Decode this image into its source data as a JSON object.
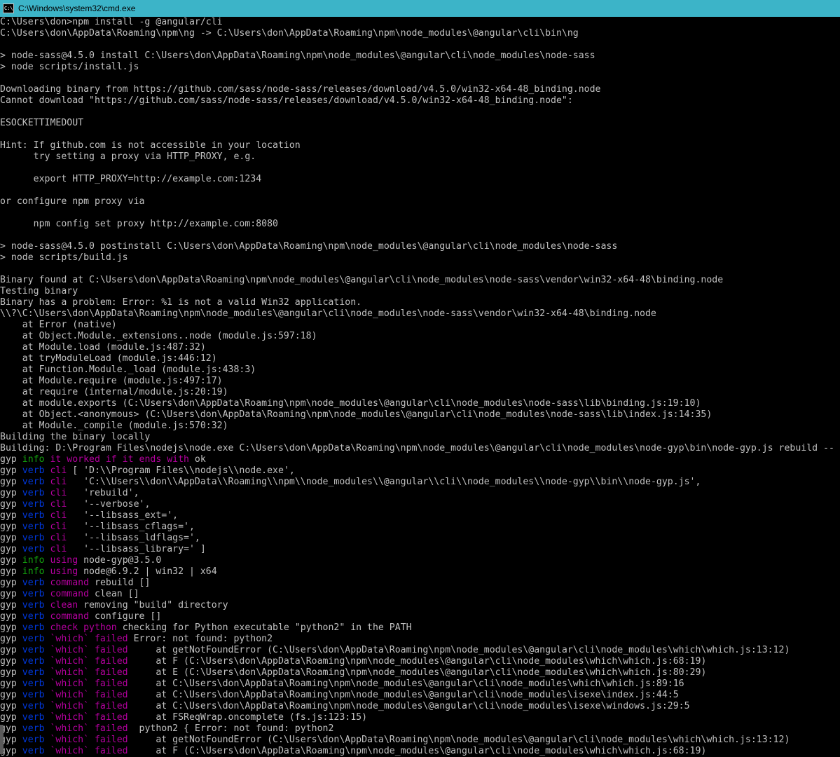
{
  "window": {
    "title": "C:\\Windows\\system32\\cmd.exe",
    "icon": "cmd-icon",
    "icon_text": "C:\\"
  },
  "colors": {
    "titlebar": "#3cb4c8",
    "background": "#000000",
    "default": "#c0c0c0",
    "green": "#13a10e",
    "magenta": "#b4009e",
    "blue": "#0037da"
  },
  "lines": [
    [
      {
        "t": "C:\\Users\\don>npm install -g @angular/cli",
        "c": "default"
      }
    ],
    [
      {
        "t": "C:\\Users\\don\\AppData\\Roaming\\npm\\ng -> C:\\Users\\don\\AppData\\Roaming\\npm\\node_modules\\@angular\\cli\\bin\\ng",
        "c": "default"
      }
    ],
    [
      {
        "t": "",
        "c": "default"
      }
    ],
    [
      {
        "t": "> node-sass@4.5.0 install C:\\Users\\don\\AppData\\Roaming\\npm\\node_modules\\@angular\\cli\\node_modules\\node-sass",
        "c": "default"
      }
    ],
    [
      {
        "t": "> node scripts/install.js",
        "c": "default"
      }
    ],
    [
      {
        "t": "",
        "c": "default"
      }
    ],
    [
      {
        "t": "Downloading binary from https://github.com/sass/node-sass/releases/download/v4.5.0/win32-x64-48_binding.node",
        "c": "default"
      }
    ],
    [
      {
        "t": "Cannot download \"https://github.com/sass/node-sass/releases/download/v4.5.0/win32-x64-48_binding.node\":",
        "c": "default"
      }
    ],
    [
      {
        "t": "",
        "c": "default"
      }
    ],
    [
      {
        "t": "ESOCKETTIMEDOUT",
        "c": "default"
      }
    ],
    [
      {
        "t": "",
        "c": "default"
      }
    ],
    [
      {
        "t": "Hint: If github.com is not accessible in your location",
        "c": "default"
      }
    ],
    [
      {
        "t": "      try setting a proxy via HTTP_PROXY, e.g.",
        "c": "default"
      }
    ],
    [
      {
        "t": "",
        "c": "default"
      }
    ],
    [
      {
        "t": "      export HTTP_PROXY=http://example.com:1234",
        "c": "default"
      }
    ],
    [
      {
        "t": "",
        "c": "default"
      }
    ],
    [
      {
        "t": "or configure npm proxy via",
        "c": "default"
      }
    ],
    [
      {
        "t": "",
        "c": "default"
      }
    ],
    [
      {
        "t": "      npm config set proxy http://example.com:8080",
        "c": "default"
      }
    ],
    [
      {
        "t": "",
        "c": "default"
      }
    ],
    [
      {
        "t": "> node-sass@4.5.0 postinstall C:\\Users\\don\\AppData\\Roaming\\npm\\node_modules\\@angular\\cli\\node_modules\\node-sass",
        "c": "default"
      }
    ],
    [
      {
        "t": "> node scripts/build.js",
        "c": "default"
      }
    ],
    [
      {
        "t": "",
        "c": "default"
      }
    ],
    [
      {
        "t": "Binary found at C:\\Users\\don\\AppData\\Roaming\\npm\\node_modules\\@angular\\cli\\node_modules\\node-sass\\vendor\\win32-x64-48\\binding.node",
        "c": "default"
      }
    ],
    [
      {
        "t": "Testing binary",
        "c": "default"
      }
    ],
    [
      {
        "t": "Binary has a problem: Error: %1 is not a valid Win32 application.",
        "c": "default"
      }
    ],
    [
      {
        "t": "\\\\?\\C:\\Users\\don\\AppData\\Roaming\\npm\\node_modules\\@angular\\cli\\node_modules\\node-sass\\vendor\\win32-x64-48\\binding.node",
        "c": "default"
      }
    ],
    [
      {
        "t": "    at Error (native)",
        "c": "default"
      }
    ],
    [
      {
        "t": "    at Object.Module._extensions..node (module.js:597:18)",
        "c": "default"
      }
    ],
    [
      {
        "t": "    at Module.load (module.js:487:32)",
        "c": "default"
      }
    ],
    [
      {
        "t": "    at tryModuleLoad (module.js:446:12)",
        "c": "default"
      }
    ],
    [
      {
        "t": "    at Function.Module._load (module.js:438:3)",
        "c": "default"
      }
    ],
    [
      {
        "t": "    at Module.require (module.js:497:17)",
        "c": "default"
      }
    ],
    [
      {
        "t": "    at require (internal/module.js:20:19)",
        "c": "default"
      }
    ],
    [
      {
        "t": "    at module.exports (C:\\Users\\don\\AppData\\Roaming\\npm\\node_modules\\@angular\\cli\\node_modules\\node-sass\\lib\\binding.js:19:10)",
        "c": "default"
      }
    ],
    [
      {
        "t": "    at Object.<anonymous> (C:\\Users\\don\\AppData\\Roaming\\npm\\node_modules\\@angular\\cli\\node_modules\\node-sass\\lib\\index.js:14:35)",
        "c": "default"
      }
    ],
    [
      {
        "t": "    at Module._compile (module.js:570:32)",
        "c": "default"
      }
    ],
    [
      {
        "t": "Building the binary locally",
        "c": "default"
      }
    ],
    [
      {
        "t": "Building: D:\\Program Files\\nodejs\\node.exe C:\\Users\\don\\AppData\\Roaming\\npm\\node_modules\\@angular\\cli\\node_modules\\node-gyp\\bin\\node-gyp.js rebuild --",
        "c": "default"
      }
    ],
    [
      {
        "t": "gyp ",
        "c": "default"
      },
      {
        "t": "info",
        "c": "green"
      },
      {
        "t": " it worked if it ends with",
        "c": "magenta"
      },
      {
        "t": " ok",
        "c": "default"
      }
    ],
    [
      {
        "t": "gyp ",
        "c": "default"
      },
      {
        "t": "verb",
        "c": "blue"
      },
      {
        "t": " cli",
        "c": "magenta"
      },
      {
        "t": " [ 'D:\\\\Program Files\\\\nodejs\\\\node.exe',",
        "c": "default"
      }
    ],
    [
      {
        "t": "gyp ",
        "c": "default"
      },
      {
        "t": "verb",
        "c": "blue"
      },
      {
        "t": " cli",
        "c": "magenta"
      },
      {
        "t": "   'C:\\\\Users\\\\don\\\\AppData\\\\Roaming\\\\npm\\\\node_modules\\\\@angular\\\\cli\\\\node_modules\\\\node-gyp\\\\bin\\\\node-gyp.js',",
        "c": "default"
      }
    ],
    [
      {
        "t": "gyp ",
        "c": "default"
      },
      {
        "t": "verb",
        "c": "blue"
      },
      {
        "t": " cli",
        "c": "magenta"
      },
      {
        "t": "   'rebuild',",
        "c": "default"
      }
    ],
    [
      {
        "t": "gyp ",
        "c": "default"
      },
      {
        "t": "verb",
        "c": "blue"
      },
      {
        "t": " cli",
        "c": "magenta"
      },
      {
        "t": "   '--verbose',",
        "c": "default"
      }
    ],
    [
      {
        "t": "gyp ",
        "c": "default"
      },
      {
        "t": "verb",
        "c": "blue"
      },
      {
        "t": " cli",
        "c": "magenta"
      },
      {
        "t": "   '--libsass_ext=',",
        "c": "default"
      }
    ],
    [
      {
        "t": "gyp ",
        "c": "default"
      },
      {
        "t": "verb",
        "c": "blue"
      },
      {
        "t": " cli",
        "c": "magenta"
      },
      {
        "t": "   '--libsass_cflags=',",
        "c": "default"
      }
    ],
    [
      {
        "t": "gyp ",
        "c": "default"
      },
      {
        "t": "verb",
        "c": "blue"
      },
      {
        "t": " cli",
        "c": "magenta"
      },
      {
        "t": "   '--libsass_ldflags=',",
        "c": "default"
      }
    ],
    [
      {
        "t": "gyp ",
        "c": "default"
      },
      {
        "t": "verb",
        "c": "blue"
      },
      {
        "t": " cli",
        "c": "magenta"
      },
      {
        "t": "   '--libsass_library=' ]",
        "c": "default"
      }
    ],
    [
      {
        "t": "gyp ",
        "c": "default"
      },
      {
        "t": "info",
        "c": "green"
      },
      {
        "t": " using",
        "c": "magenta"
      },
      {
        "t": " node-gyp@3.5.0",
        "c": "default"
      }
    ],
    [
      {
        "t": "gyp ",
        "c": "default"
      },
      {
        "t": "info",
        "c": "green"
      },
      {
        "t": " using",
        "c": "magenta"
      },
      {
        "t": " node@6.9.2 | win32 | x64",
        "c": "default"
      }
    ],
    [
      {
        "t": "gyp ",
        "c": "default"
      },
      {
        "t": "verb",
        "c": "blue"
      },
      {
        "t": " command",
        "c": "magenta"
      },
      {
        "t": " rebuild []",
        "c": "default"
      }
    ],
    [
      {
        "t": "gyp ",
        "c": "default"
      },
      {
        "t": "verb",
        "c": "blue"
      },
      {
        "t": " command",
        "c": "magenta"
      },
      {
        "t": " clean []",
        "c": "default"
      }
    ],
    [
      {
        "t": "gyp ",
        "c": "default"
      },
      {
        "t": "verb",
        "c": "blue"
      },
      {
        "t": " clean",
        "c": "magenta"
      },
      {
        "t": " removing \"build\" directory",
        "c": "default"
      }
    ],
    [
      {
        "t": "gyp ",
        "c": "default"
      },
      {
        "t": "verb",
        "c": "blue"
      },
      {
        "t": " command",
        "c": "magenta"
      },
      {
        "t": " configure []",
        "c": "default"
      }
    ],
    [
      {
        "t": "gyp ",
        "c": "default"
      },
      {
        "t": "verb",
        "c": "blue"
      },
      {
        "t": " check python",
        "c": "magenta"
      },
      {
        "t": " checking for Python executable \"python2\" in the PATH",
        "c": "default"
      }
    ],
    [
      {
        "t": "gyp ",
        "c": "default"
      },
      {
        "t": "verb",
        "c": "blue"
      },
      {
        "t": " `which` failed",
        "c": "magenta"
      },
      {
        "t": " Error: not found: python2",
        "c": "default"
      }
    ],
    [
      {
        "t": "gyp ",
        "c": "default"
      },
      {
        "t": "verb",
        "c": "blue"
      },
      {
        "t": " `which` failed",
        "c": "magenta"
      },
      {
        "t": "     at getNotFoundError (C:\\Users\\don\\AppData\\Roaming\\npm\\node_modules\\@angular\\cli\\node_modules\\which\\which.js:13:12)",
        "c": "default"
      }
    ],
    [
      {
        "t": "gyp ",
        "c": "default"
      },
      {
        "t": "verb",
        "c": "blue"
      },
      {
        "t": " `which` failed",
        "c": "magenta"
      },
      {
        "t": "     at F (C:\\Users\\don\\AppData\\Roaming\\npm\\node_modules\\@angular\\cli\\node_modules\\which\\which.js:68:19)",
        "c": "default"
      }
    ],
    [
      {
        "t": "gyp ",
        "c": "default"
      },
      {
        "t": "verb",
        "c": "blue"
      },
      {
        "t": " `which` failed",
        "c": "magenta"
      },
      {
        "t": "     at E (C:\\Users\\don\\AppData\\Roaming\\npm\\node_modules\\@angular\\cli\\node_modules\\which\\which.js:80:29)",
        "c": "default"
      }
    ],
    [
      {
        "t": "gyp ",
        "c": "default"
      },
      {
        "t": "verb",
        "c": "blue"
      },
      {
        "t": " `which` failed",
        "c": "magenta"
      },
      {
        "t": "     at C:\\Users\\don\\AppData\\Roaming\\npm\\node_modules\\@angular\\cli\\node_modules\\which\\which.js:89:16",
        "c": "default"
      }
    ],
    [
      {
        "t": "gyp ",
        "c": "default"
      },
      {
        "t": "verb",
        "c": "blue"
      },
      {
        "t": " `which` failed",
        "c": "magenta"
      },
      {
        "t": "     at C:\\Users\\don\\AppData\\Roaming\\npm\\node_modules\\@angular\\cli\\node_modules\\isexe\\index.js:44:5",
        "c": "default"
      }
    ],
    [
      {
        "t": "gyp ",
        "c": "default"
      },
      {
        "t": "verb",
        "c": "blue"
      },
      {
        "t": " `which` failed",
        "c": "magenta"
      },
      {
        "t": "     at C:\\Users\\don\\AppData\\Roaming\\npm\\node_modules\\@angular\\cli\\node_modules\\isexe\\windows.js:29:5",
        "c": "default"
      }
    ],
    [
      {
        "t": "gyp ",
        "c": "default"
      },
      {
        "t": "verb",
        "c": "blue"
      },
      {
        "t": " `which` failed",
        "c": "magenta"
      },
      {
        "t": "     at FSReqWrap.oncomplete (fs.js:123:15)",
        "c": "default"
      }
    ],
    [
      {
        "t": "gyp ",
        "c": "default"
      },
      {
        "t": "verb",
        "c": "blue"
      },
      {
        "t": " `which` failed",
        "c": "magenta"
      },
      {
        "t": "  python2 { Error: not found: python2",
        "c": "default"
      }
    ],
    [
      {
        "t": "gyp ",
        "c": "default"
      },
      {
        "t": "verb",
        "c": "blue"
      },
      {
        "t": " `which` failed",
        "c": "magenta"
      },
      {
        "t": "     at getNotFoundError (C:\\Users\\don\\AppData\\Roaming\\npm\\node_modules\\@angular\\cli\\node_modules\\which\\which.js:13:12)",
        "c": "default"
      }
    ],
    [
      {
        "t": "gyp ",
        "c": "default"
      },
      {
        "t": "verb",
        "c": "blue"
      },
      {
        "t": " `which` failed",
        "c": "magenta"
      },
      {
        "t": "     at F (C:\\Users\\don\\AppData\\Roaming\\npm\\node_modules\\@angular\\cli\\node_modules\\which\\which.js:68:19)",
        "c": "default"
      }
    ]
  ]
}
